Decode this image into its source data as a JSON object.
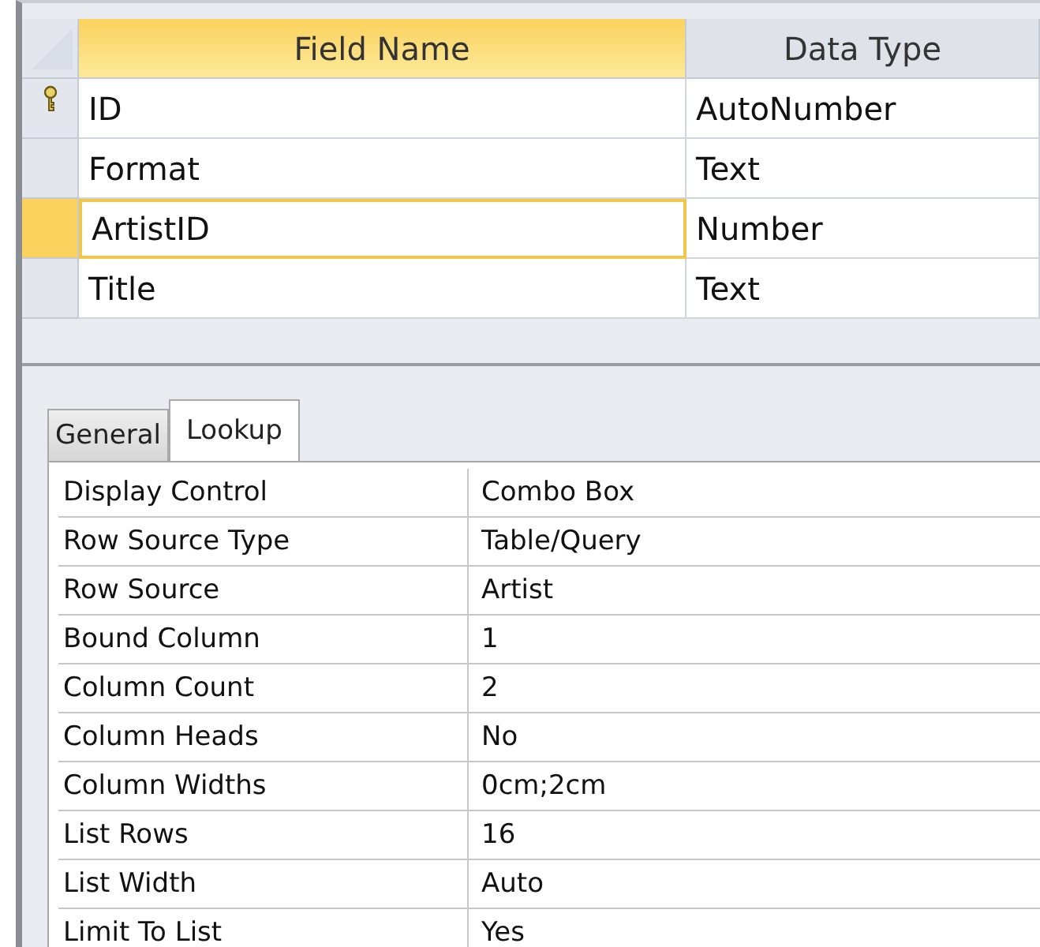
{
  "table": {
    "columns": [
      {
        "label": "Field Name",
        "selected": true
      },
      {
        "label": "Data Type",
        "selected": false
      }
    ],
    "rows": [
      {
        "field_name": "ID",
        "data_type": "AutoNumber",
        "primary_key": true,
        "selected": false
      },
      {
        "field_name": "Format",
        "data_type": "Text",
        "primary_key": false,
        "selected": false
      },
      {
        "field_name": "ArtistID",
        "data_type": "Number",
        "primary_key": false,
        "selected": true
      },
      {
        "field_name": "Title",
        "data_type": "Text",
        "primary_key": false,
        "selected": false
      }
    ]
  },
  "property_tabs": [
    {
      "label": "General",
      "selected": false
    },
    {
      "label": "Lookup",
      "selected": true
    }
  ],
  "properties": [
    {
      "name": "Display Control",
      "value": "Combo Box"
    },
    {
      "name": "Row Source Type",
      "value": "Table/Query"
    },
    {
      "name": "Row Source",
      "value": "Artist"
    },
    {
      "name": "Bound Column",
      "value": "1"
    },
    {
      "name": "Column Count",
      "value": "2"
    },
    {
      "name": "Column Heads",
      "value": "No"
    },
    {
      "name": "Column Widths",
      "value": "0cm;2cm"
    },
    {
      "name": "List Rows",
      "value": "16"
    },
    {
      "name": "List Width",
      "value": "Auto"
    },
    {
      "name": "Limit To List",
      "value": "Yes"
    }
  ]
}
